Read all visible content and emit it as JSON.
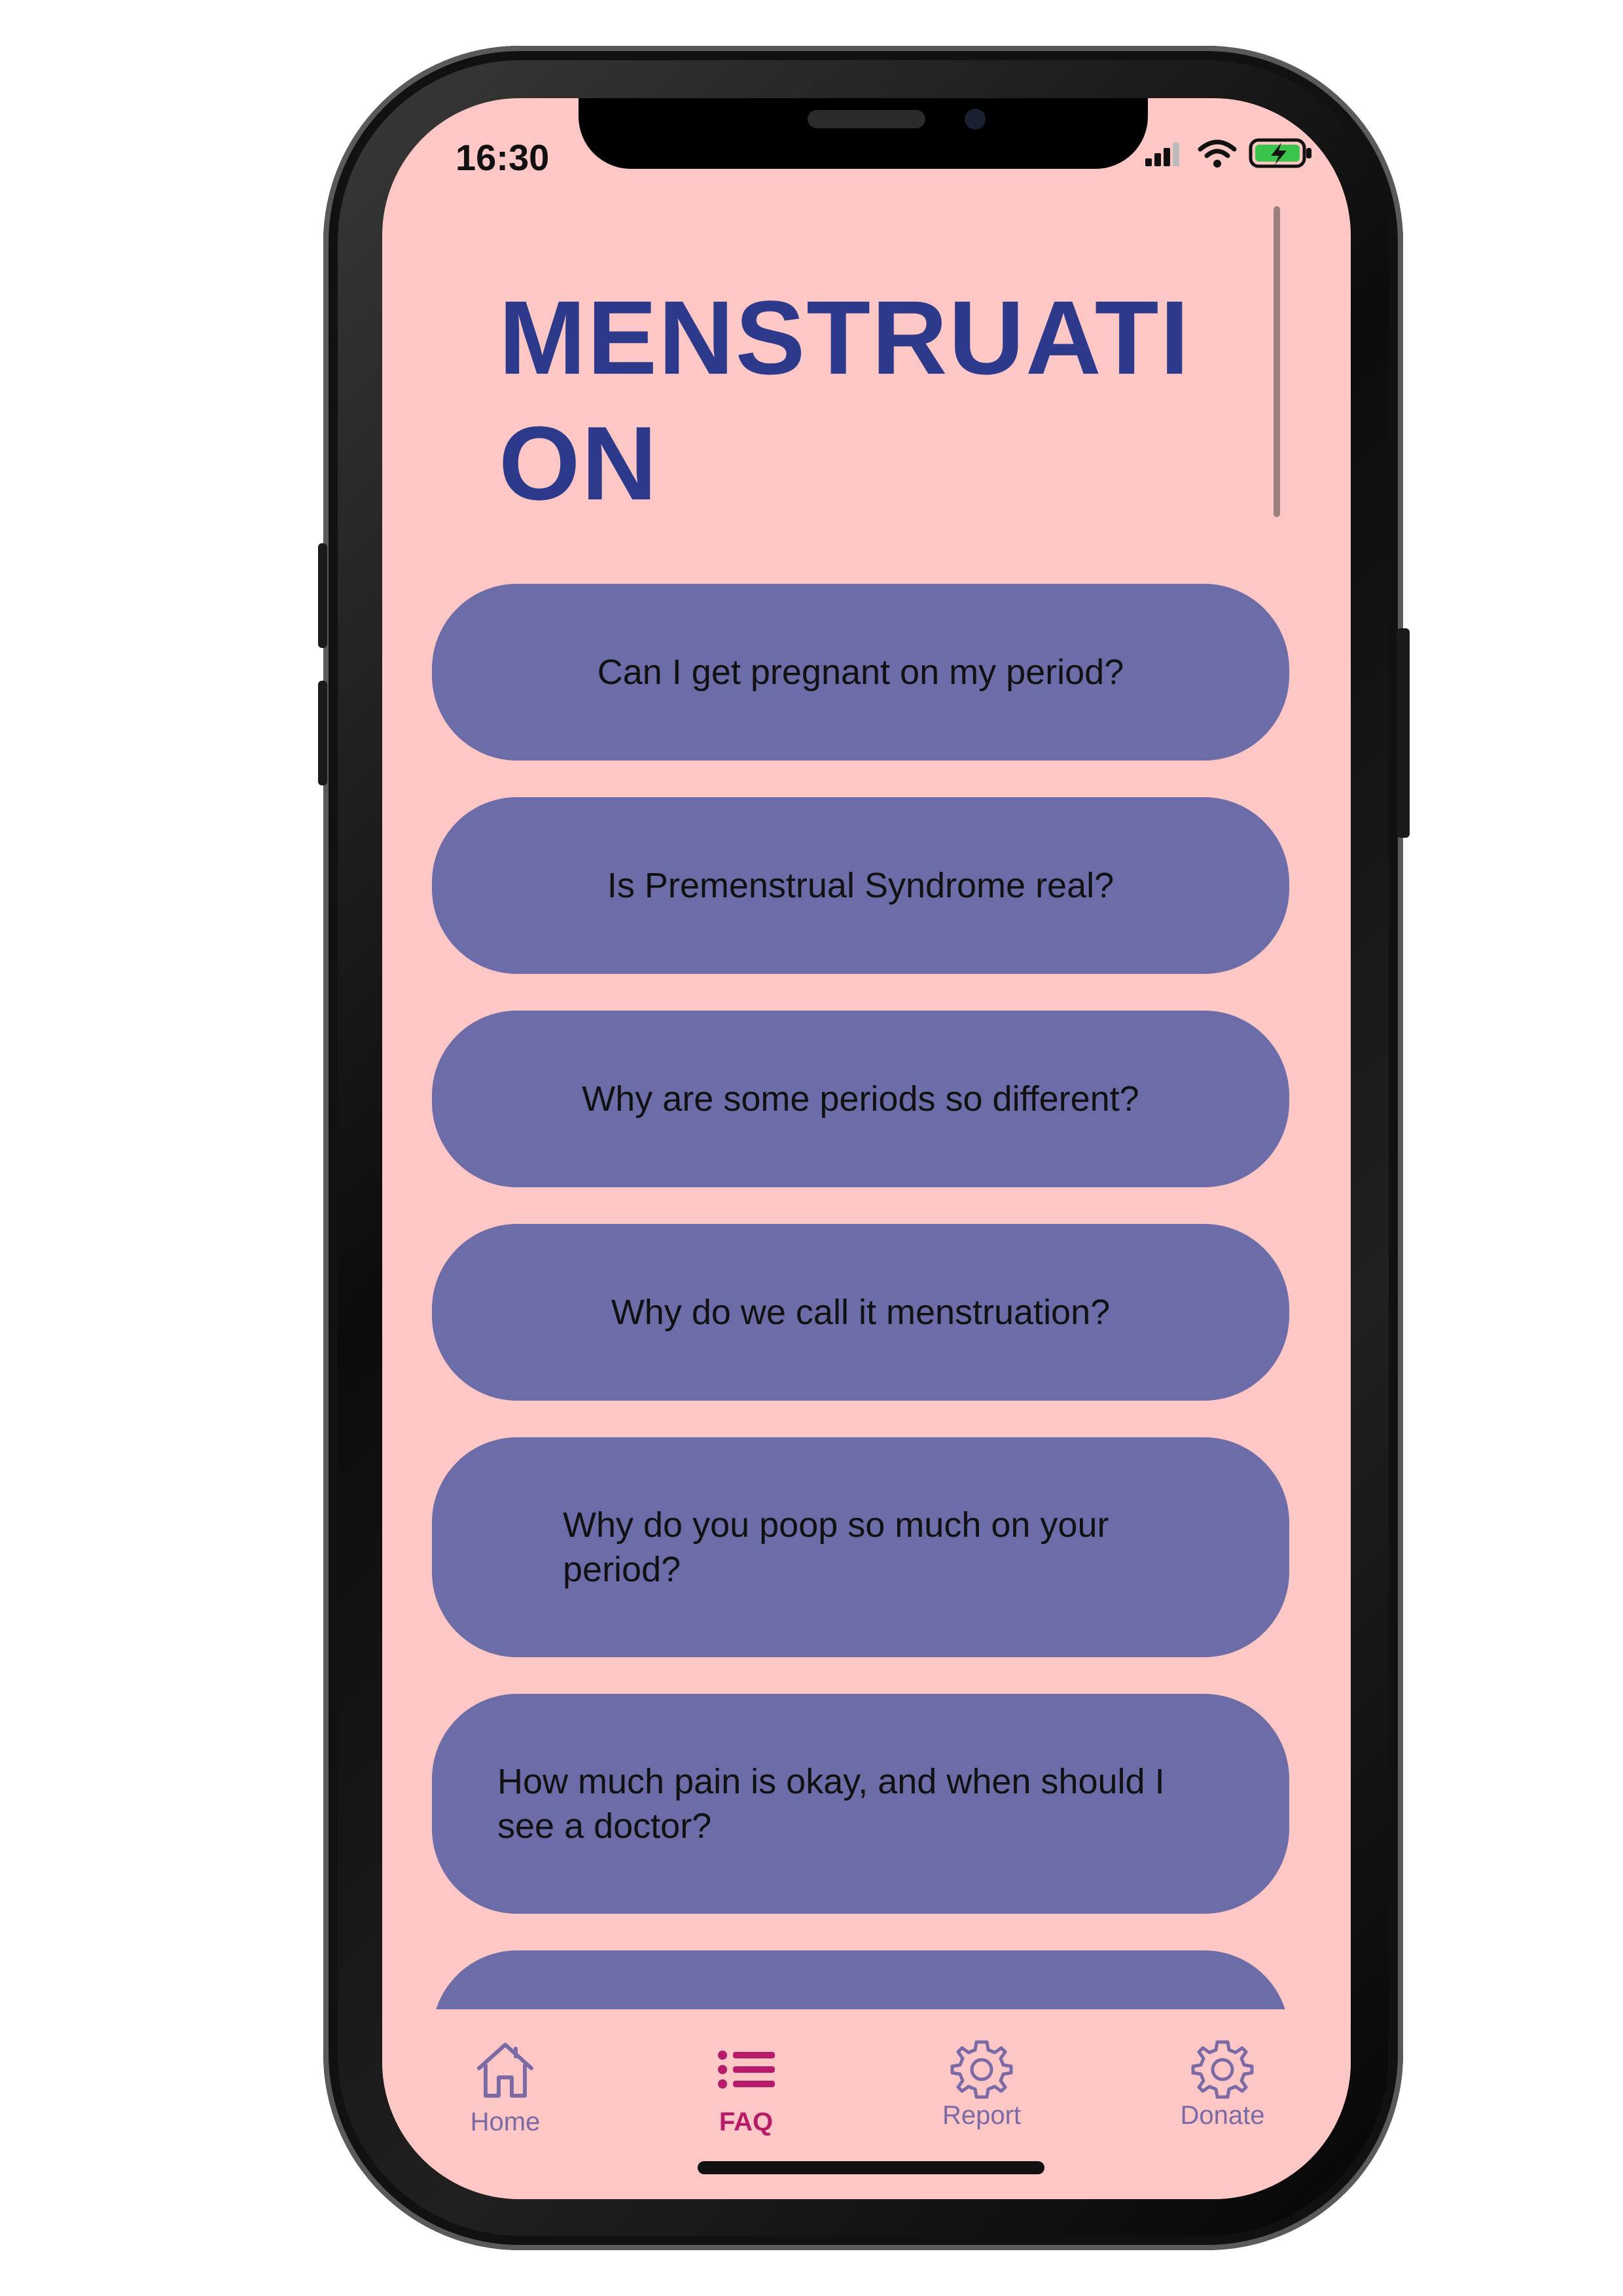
{
  "status_bar": {
    "time": "16:30",
    "icons": [
      "cellular-signal-icon",
      "wifi-icon",
      "battery-charging-icon"
    ]
  },
  "page": {
    "title_line1": "MENSTRUATI",
    "title_line2": "ON"
  },
  "faq": {
    "items": [
      {
        "label": "Can I get pregnant on my period?"
      },
      {
        "label": "Is Premenstrual Syndrome real?"
      },
      {
        "label": "Why are some periods so different?"
      },
      {
        "label": "Why do we call it menstruation?"
      },
      {
        "label_line1": "Why do you poop so much on your",
        "label_line2": "period?"
      },
      {
        "label_line1": "How much pain is okay, and when should I",
        "label_line2": "see a doctor?"
      }
    ]
  },
  "nav": {
    "items": [
      {
        "label": "Home",
        "icon": "home-icon"
      },
      {
        "label": "FAQ",
        "icon": "list-icon",
        "active": true
      },
      {
        "label": "Report",
        "icon": "gear-icon"
      },
      {
        "label": "Donate",
        "icon": "gear-icon"
      }
    ]
  },
  "colors": {
    "background": "#fcc7c4",
    "title": "#2d3a8c",
    "card": "#6c6ca8",
    "nav_active": "#b71b6a",
    "nav_inactive": "#7a6aa6"
  }
}
